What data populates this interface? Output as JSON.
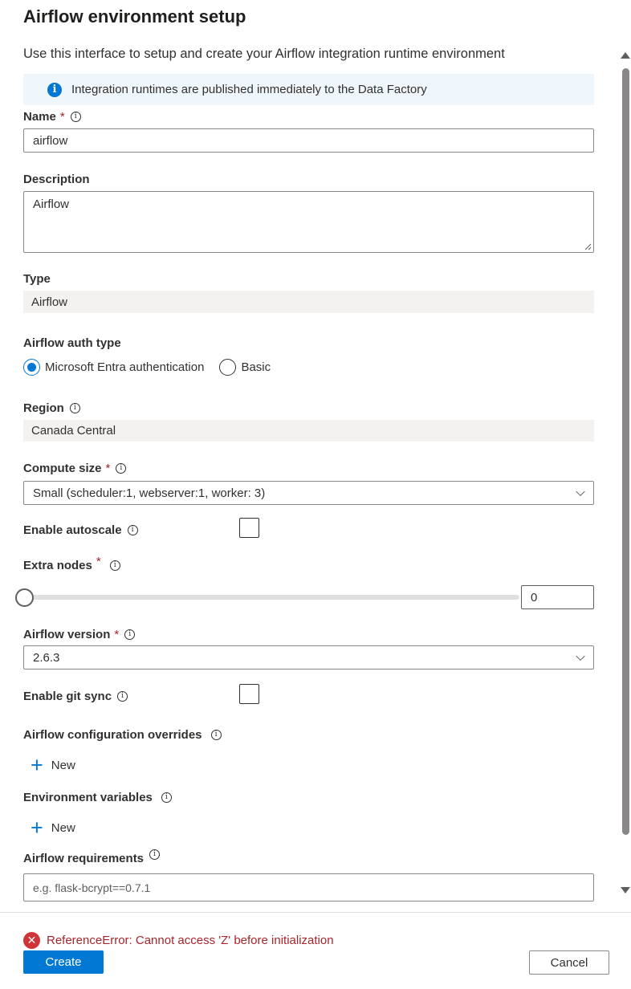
{
  "header": {
    "title": "Airflow environment setup",
    "subtitle": "Use this interface to setup and create your Airflow integration runtime environment"
  },
  "info": {
    "text": "Integration runtimes are published immediately to the Data Factory",
    "icon": "info-icon"
  },
  "form": {
    "name": {
      "label": "Name",
      "value": "airflow",
      "required": "*"
    },
    "description": {
      "label": "Description",
      "value": "Airflow"
    },
    "type": {
      "label": "Type",
      "value": "Airflow"
    },
    "auth": {
      "label": "Airflow auth type",
      "options": [
        "Microsoft Entra authentication",
        "Basic"
      ],
      "selected": "Microsoft Entra authentication"
    },
    "region": {
      "label": "Region",
      "value": "Canada Central"
    },
    "compute": {
      "label": "Compute size",
      "value": "Small (scheduler:1, webserver:1, worker: 3)",
      "required": "*"
    },
    "autoscale": {
      "label": "Enable autoscale",
      "checked": false
    },
    "extra_nodes": {
      "label": "Extra nodes",
      "value": "0",
      "required": "*"
    },
    "version": {
      "label": "Airflow version",
      "value": "2.6.3",
      "required": "*"
    },
    "git_sync": {
      "label": "Enable git sync",
      "checked": false
    },
    "config_overrides": {
      "label": "Airflow configuration overrides",
      "new_label": "New"
    },
    "env_vars": {
      "label": "Environment variables",
      "new_label": "New"
    },
    "requirements": {
      "label": "Airflow requirements",
      "placeholder": "e.g. flask-bcrypt==0.7.1"
    }
  },
  "footer": {
    "error": "ReferenceError: Cannot access 'Z' before initialization",
    "create_label": "Create",
    "cancel_label": "Cancel"
  },
  "colors": {
    "accent": "#0078d4",
    "error": "#a4262c",
    "readonly_bg": "#f3f2f1",
    "info_bg": "#eff6fc"
  }
}
